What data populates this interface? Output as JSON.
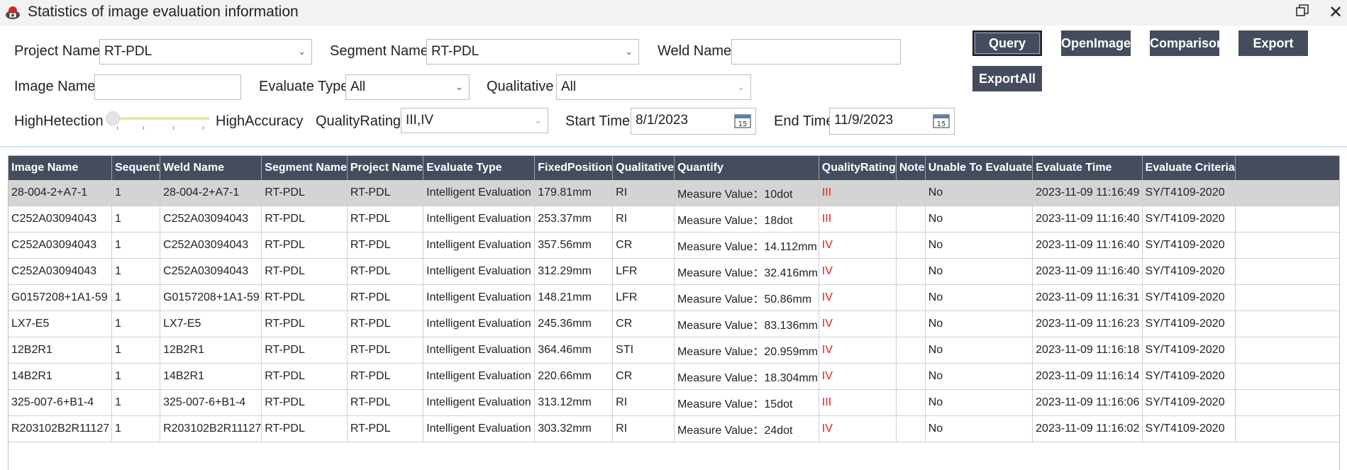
{
  "window": {
    "title": "Statistics of image evaluation information"
  },
  "form": {
    "project_name_label": "Project Name",
    "project_name_value": "RT-PDL",
    "segment_name_label": "Segment Name",
    "segment_name_value": "RT-PDL",
    "weld_name_label": "Weld Name",
    "weld_name_value": "",
    "image_name_label": "Image Name",
    "image_name_value": "",
    "evaluate_type_label": "Evaluate Type",
    "evaluate_type_value": "All",
    "qualitative_label": "Qualitative",
    "qualitative_value": "All",
    "slider_left_label": "HighHetection",
    "slider_right_label": "HighAccuracy",
    "slider_value": 0,
    "quality_rating_label": "QualityRating",
    "quality_rating_value": "III,IV",
    "start_time_label": "Start Time",
    "start_time_value": "8/1/2023",
    "end_time_label": "End Time",
    "end_time_value": "11/9/2023"
  },
  "buttons": {
    "query": "Query",
    "open_image": "OpenImage",
    "comparison": "Comparison",
    "export": "Export",
    "export_all": "ExportAll"
  },
  "table": {
    "columns": [
      "Image Name",
      "Sequent",
      "Weld Name",
      "Segment Name",
      "Project Name",
      "Evaluate Type",
      "FixedPosition",
      "Qualitative",
      "Quantify",
      "QualityRating",
      "Note",
      "Unable To Evaluate",
      "Evaluate Time",
      "Evaluate Criteria"
    ],
    "rows": [
      [
        "28-004-2+A7-1",
        "1",
        "28-004-2+A7-1",
        "RT-PDL",
        "RT-PDL",
        "Intelligent Evaluation",
        "179.81mm",
        "RI",
        "Measure Value：10dot",
        "III",
        "",
        "No",
        "2023-11-09 11:16:49",
        "SY/T4109-2020"
      ],
      [
        "C252A03094043",
        "1",
        "C252A03094043",
        "RT-PDL",
        "RT-PDL",
        "Intelligent Evaluation",
        "253.37mm",
        "RI",
        "Measure Value：18dot",
        "III",
        "",
        "No",
        "2023-11-09 11:16:40",
        "SY/T4109-2020"
      ],
      [
        "C252A03094043",
        "1",
        "C252A03094043",
        "RT-PDL",
        "RT-PDL",
        "Intelligent Evaluation",
        "357.56mm",
        "CR",
        "Measure Value：14.112mm",
        "IV",
        "",
        "No",
        "2023-11-09 11:16:40",
        "SY/T4109-2020"
      ],
      [
        "C252A03094043",
        "1",
        "C252A03094043",
        "RT-PDL",
        "RT-PDL",
        "Intelligent Evaluation",
        "312.29mm",
        "LFR",
        "Measure Value：32.416mm",
        "IV",
        "",
        "No",
        "2023-11-09 11:16:40",
        "SY/T4109-2020"
      ],
      [
        "G0157208+1A1-59",
        "1",
        "G0157208+1A1-59",
        "RT-PDL",
        "RT-PDL",
        "Intelligent Evaluation",
        "148.21mm",
        "LFR",
        "Measure Value：50.86mm",
        "IV",
        "",
        "No",
        "2023-11-09 11:16:31",
        "SY/T4109-2020"
      ],
      [
        "LX7-E5",
        "1",
        "LX7-E5",
        "RT-PDL",
        "RT-PDL",
        "Intelligent Evaluation",
        "245.36mm",
        "CR",
        "Measure Value：83.136mm",
        "IV",
        "",
        "No",
        "2023-11-09 11:16:23",
        "SY/T4109-2020"
      ],
      [
        "12B2R1",
        "1",
        "12B2R1",
        "RT-PDL",
        "RT-PDL",
        "Intelligent Evaluation",
        "364.46mm",
        "STI",
        "Measure Value：20.959mm",
        "IV",
        "",
        "No",
        "2023-11-09 11:16:18",
        "SY/T4109-2020"
      ],
      [
        "14B2R1",
        "1",
        "14B2R1",
        "RT-PDL",
        "RT-PDL",
        "Intelligent Evaluation",
        "220.66mm",
        "CR",
        "Measure Value：18.304mm",
        "IV",
        "",
        "No",
        "2023-11-09 11:16:14",
        "SY/T4109-2020"
      ],
      [
        "325-007-6+B1-4",
        "1",
        "325-007-6+B1-4",
        "RT-PDL",
        "RT-PDL",
        "Intelligent Evaluation",
        "313.12mm",
        "RI",
        "Measure Value：15dot",
        "III",
        "",
        "No",
        "2023-11-09 11:16:06",
        "SY/T4109-2020"
      ],
      [
        "R203102B2R11127",
        "1",
        "R203102B2R11127",
        "RT-PDL",
        "RT-PDL",
        "Intelligent Evaluation",
        "303.32mm",
        "RI",
        "Measure Value：24dot",
        "IV",
        "",
        "No",
        "2023-11-09 11:16:02",
        "SY/T4109-2020"
      ]
    ],
    "selected_row": 0
  },
  "icons": {
    "app": "app-logo-icon",
    "restore": "restore-window-icon",
    "close": "close-icon",
    "dropdown": "chevron-down-icon",
    "calendar": "calendar-icon"
  },
  "colors": {
    "button_bg": "#444c5e",
    "header_bg": "#444c5e",
    "rating_text": "#e81c1c",
    "selected_row": "#d4d4d4"
  }
}
